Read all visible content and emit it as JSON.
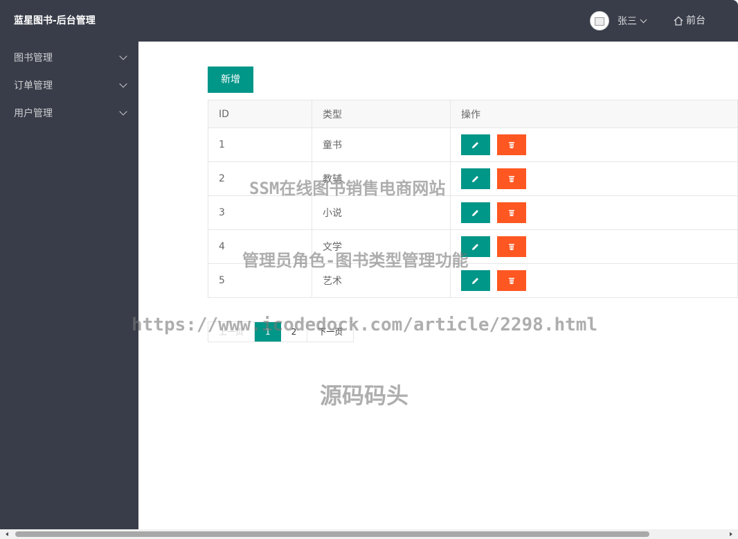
{
  "header": {
    "title": "蓝星图书-后台管理",
    "user_name": "张三",
    "front_link": "前台"
  },
  "sidebar": {
    "items": [
      {
        "label": "图书管理"
      },
      {
        "label": "订单管理"
      },
      {
        "label": "用户管理"
      }
    ]
  },
  "toolbar": {
    "add_label": "新增"
  },
  "table": {
    "headers": [
      "ID",
      "类型",
      "操作"
    ],
    "rows": [
      {
        "id": "1",
        "type": "童书"
      },
      {
        "id": "2",
        "type": "教辅"
      },
      {
        "id": "3",
        "type": "小说"
      },
      {
        "id": "4",
        "type": "文学"
      },
      {
        "id": "5",
        "type": "艺术"
      }
    ]
  },
  "pagination": {
    "prev_label": "上一页",
    "pages": [
      "1",
      "2"
    ],
    "current_page": "1",
    "next_label": "下一页"
  },
  "watermarks": {
    "line1": "SSM在线图书销售电商网站",
    "line2": "管理员角色-图书类型管理功能",
    "line3": "https://www.icodedock.com/article/2298.html",
    "line4": "源码码头"
  },
  "colors": {
    "header_bg": "#393d49",
    "primary": "#009688",
    "danger": "#ff5722"
  }
}
